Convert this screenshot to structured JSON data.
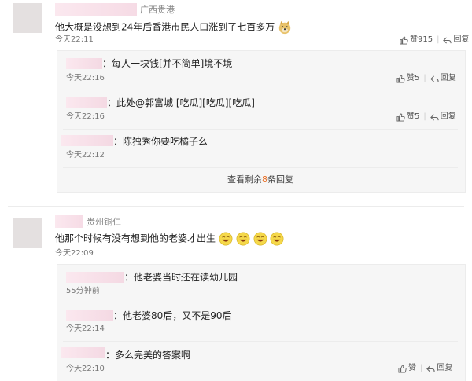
{
  "comments": [
    {
      "location": "广西贵港",
      "text": "他大概是没想到24年后香港市民人口涨到了七百多万",
      "time": "今天22:11",
      "like_label": "赞",
      "like_count": "915",
      "reply_label": "回复",
      "replies": [
        {
          "text": "：每人一块钱[并不简单]境不境",
          "time": "今天22:16",
          "like_label": "赞",
          "like_count": "5",
          "reply_label": "回复"
        },
        {
          "text": "：此处@郭富城 [吃瓜][吃瓜][吃瓜]",
          "time": "今天22:16",
          "like_label": "赞",
          "like_count": "5",
          "reply_label": "回复"
        },
        {
          "text": "：陈独秀你要吃橘子么",
          "time": "今天22:12"
        }
      ],
      "more": {
        "prefix": "查看剩余",
        "count": "8",
        "suffix": "条回复"
      }
    },
    {
      "location": "贵州铜仁",
      "text": "他那个时候有没有想到他的老婆才出生",
      "time": "今天22:09",
      "replies": [
        {
          "text": "：他老婆当时还在读幼儿园",
          "time": "55分钟前"
        },
        {
          "text": "：他老婆80后，又不是90后",
          "time": "今天22:14"
        },
        {
          "text": "：多么完美的答案啊",
          "time": "今天22:10",
          "like_label": "赞",
          "reply_label": "回复"
        }
      ]
    }
  ],
  "icons": {
    "like": "thumbs-up-icon",
    "reply": "reply-arrow-icon",
    "doge": "doge-emoji-icon",
    "laugh": "laughing-emoji-icon"
  },
  "colors": {
    "highlight": "#e86d22",
    "blur_pink": "#f8dfe8"
  }
}
